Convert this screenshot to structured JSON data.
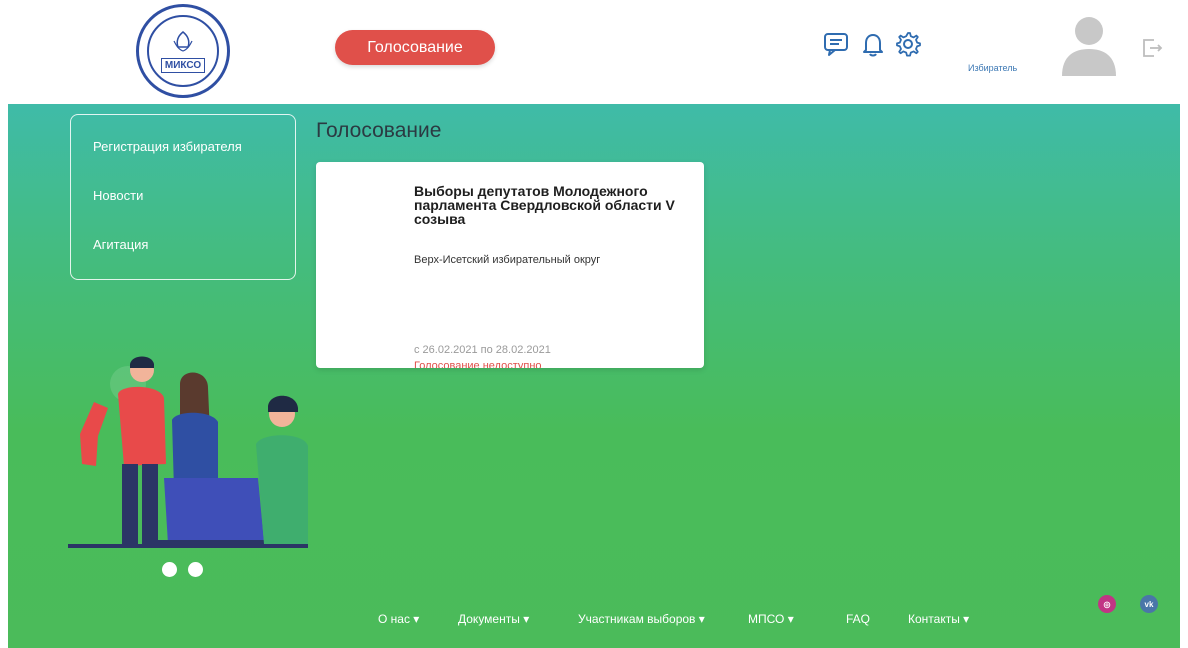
{
  "header": {
    "logo_text": "МИКСО",
    "vote_button": "Голосование",
    "icons": [
      "chat-icon",
      "bell-icon",
      "gear-icon"
    ],
    "user_role": "Избиратель",
    "logout_icon": "logout-icon"
  },
  "sidebar": {
    "items": [
      {
        "label": "Регистрация избирателя"
      },
      {
        "label": "Новости"
      },
      {
        "label": "Агитация"
      }
    ]
  },
  "main": {
    "title": "Голосование",
    "card": {
      "title": "Выборы депутатов Молодежного парламента Свердловской области V созыва",
      "district": "Верх-Исетский избирательный округ",
      "dates": "с 26.02.2021 по 28.02.2021",
      "status": "Голосование недоступно"
    }
  },
  "footer": {
    "nav": [
      {
        "label": "О нас"
      },
      {
        "label": "Документы"
      },
      {
        "label": "Участникам выборов"
      },
      {
        "label": "МПСО"
      },
      {
        "label": "FAQ"
      },
      {
        "label": "Контакты"
      }
    ],
    "social": [
      "instagram-icon",
      "vk-icon"
    ],
    "social_labels": {
      "instagram": "◎",
      "vk": "vk"
    }
  },
  "colors": {
    "accent_red": "#e0504a",
    "icon_blue": "#2f6cb0",
    "gradient_top": "#3fbba8",
    "gradient_bottom": "#4bbb5a"
  }
}
